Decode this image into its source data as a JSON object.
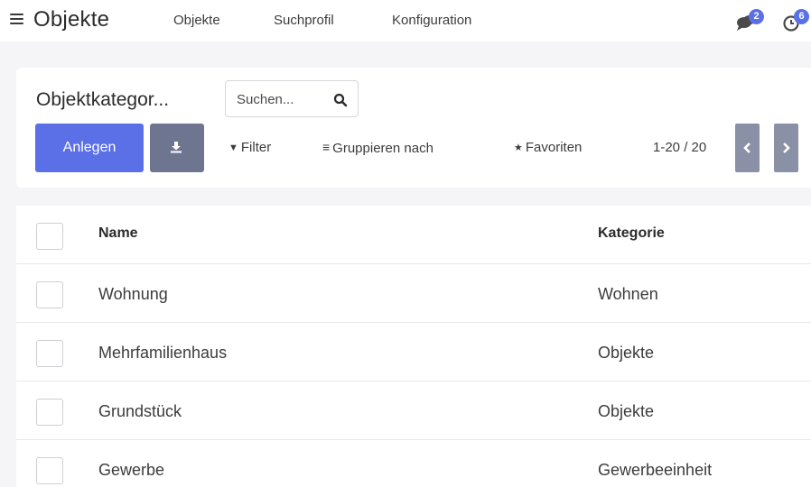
{
  "navbar": {
    "app_title": "Objekte",
    "menu": [
      "Objekte",
      "Suchprofil",
      "Konfiguration"
    ],
    "messages_count": "2",
    "activities_count": "6"
  },
  "control_panel": {
    "title": "Objektkategor...",
    "search_placeholder": "Suchen...",
    "create_label": "Anlegen",
    "filter_label": "Filter",
    "group_by_label": "Gruppieren nach",
    "favorites_label": "Favoriten",
    "pager": "1-20 / 20"
  },
  "list": {
    "columns": [
      "Name",
      "Kategorie"
    ],
    "rows": [
      {
        "name": "Wohnung",
        "category": "Wohnen"
      },
      {
        "name": "Mehrfamilienhaus",
        "category": "Objekte"
      },
      {
        "name": "Grundstück",
        "category": "Objekte"
      },
      {
        "name": "Gewerbe",
        "category": "Gewerbeeinheit"
      }
    ]
  },
  "colors": {
    "primary": "#5b6fe6",
    "secondary": "#6e7590",
    "pager": "#8a90a6"
  },
  "icons": {
    "menu": "hamburger-icon",
    "search": "search-icon",
    "download": "download-icon",
    "filter": "filter-icon",
    "group": "list-icon",
    "favorites": "star-icon",
    "prev": "chevron-left-icon",
    "next": "chevron-right-icon",
    "messages": "chat-icon",
    "activities": "clock-icon"
  }
}
